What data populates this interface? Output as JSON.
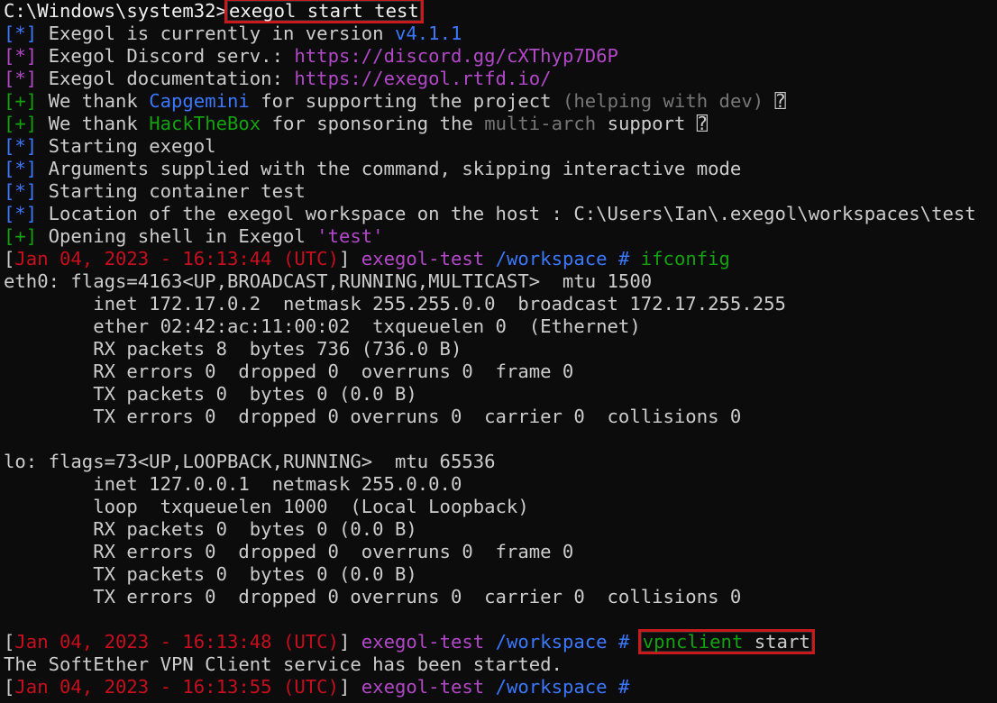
{
  "colors": {
    "background": "#0c0c0c",
    "default": "#cccccc",
    "bright": "#f2f2f2",
    "blue": "#3b78ff",
    "magenta": "#b148c6",
    "green": "#13a10e",
    "red": "#c50f1f",
    "gray": "#767676",
    "highlight_border": "#c8191c"
  },
  "lines": [
    [
      {
        "t": "C:\\Windows\\system32>",
        "c": "bright"
      },
      {
        "t": "exegol start test",
        "c": "bright",
        "hl": true
      }
    ],
    [
      {
        "t": "[*]",
        "c": "blue"
      },
      {
        "t": " Exegol is currently in version ",
        "c": "default"
      },
      {
        "t": "v4.1.1",
        "c": "blue"
      }
    ],
    [
      {
        "t": "[*]",
        "c": "magenta"
      },
      {
        "t": " Exegol Discord serv.: ",
        "c": "default"
      },
      {
        "t": "https://discord.gg/cXThyp7D6P",
        "c": "magenta"
      }
    ],
    [
      {
        "t": "[*]",
        "c": "magenta"
      },
      {
        "t": " Exegol documentation: ",
        "c": "default"
      },
      {
        "t": "https://exegol.rtfd.io/",
        "c": "magenta"
      }
    ],
    [
      {
        "t": "[+]",
        "c": "green"
      },
      {
        "t": " We thank ",
        "c": "default"
      },
      {
        "t": "Capgemini",
        "c": "blue"
      },
      {
        "t": " for supporting the project ",
        "c": "default"
      },
      {
        "t": "(helping with dev)",
        "c": "gray"
      },
      {
        "t": " ⍰",
        "c": "default"
      }
    ],
    [
      {
        "t": "[+]",
        "c": "green"
      },
      {
        "t": " We thank ",
        "c": "default"
      },
      {
        "t": "HackTheBox",
        "c": "green"
      },
      {
        "t": " for sponsoring the ",
        "c": "default"
      },
      {
        "t": "multi-arch",
        "c": "gray"
      },
      {
        "t": " support ⍰",
        "c": "default"
      }
    ],
    [
      {
        "t": "[*]",
        "c": "blue"
      },
      {
        "t": " Starting exegol",
        "c": "default"
      }
    ],
    [
      {
        "t": "[*]",
        "c": "blue"
      },
      {
        "t": " Arguments supplied with the command, skipping interactive mode",
        "c": "default"
      }
    ],
    [
      {
        "t": "[*]",
        "c": "blue"
      },
      {
        "t": " Starting container test",
        "c": "default"
      }
    ],
    [
      {
        "t": "[*]",
        "c": "blue"
      },
      {
        "t": " Location of the exegol workspace on the host : C:\\Users\\Ian\\.exegol\\workspaces\\test",
        "c": "default"
      }
    ],
    [
      {
        "t": "[+]",
        "c": "green"
      },
      {
        "t": " Opening shell in Exegol ",
        "c": "default"
      },
      {
        "t": "'test'",
        "c": "magenta"
      }
    ],
    [
      {
        "t": "[",
        "c": "default"
      },
      {
        "t": "Jan 04, 2023 - 16:13:44 (UTC)",
        "c": "red"
      },
      {
        "t": "]",
        "c": "default"
      },
      {
        "t": " exegol-test",
        "c": "magenta"
      },
      {
        "t": " /workspace #",
        "c": "blue"
      },
      {
        "t": " ifconfig",
        "c": "green"
      }
    ],
    [
      {
        "t": "eth0: flags=4163<UP,BROADCAST,RUNNING,MULTICAST>  mtu 1500",
        "c": "default"
      }
    ],
    [
      {
        "t": "        inet 172.17.0.2  netmask 255.255.0.0  broadcast 172.17.255.255",
        "c": "default"
      }
    ],
    [
      {
        "t": "        ether 02:42:ac:11:00:02  txqueuelen 0  (Ethernet)",
        "c": "default"
      }
    ],
    [
      {
        "t": "        RX packets 8  bytes 736 (736.0 B)",
        "c": "default"
      }
    ],
    [
      {
        "t": "        RX errors 0  dropped 0  overruns 0  frame 0",
        "c": "default"
      }
    ],
    [
      {
        "t": "        TX packets 0  bytes 0 (0.0 B)",
        "c": "default"
      }
    ],
    [
      {
        "t": "        TX errors 0  dropped 0 overruns 0  carrier 0  collisions 0",
        "c": "default"
      }
    ],
    [
      {
        "t": "",
        "c": "default"
      }
    ],
    [
      {
        "t": "lo: flags=73<UP,LOOPBACK,RUNNING>  mtu 65536",
        "c": "default"
      }
    ],
    [
      {
        "t": "        inet 127.0.0.1  netmask 255.0.0.0",
        "c": "default"
      }
    ],
    [
      {
        "t": "        loop  txqueuelen 1000  (Local Loopback)",
        "c": "default"
      }
    ],
    [
      {
        "t": "        RX packets 0  bytes 0 (0.0 B)",
        "c": "default"
      }
    ],
    [
      {
        "t": "        RX errors 0  dropped 0  overruns 0  frame 0",
        "c": "default"
      }
    ],
    [
      {
        "t": "        TX packets 0  bytes 0 (0.0 B)",
        "c": "default"
      }
    ],
    [
      {
        "t": "        TX errors 0  dropped 0 overruns 0  carrier 0  collisions 0",
        "c": "default"
      }
    ],
    [
      {
        "t": "",
        "c": "default"
      }
    ],
    [
      {
        "t": "[",
        "c": "default"
      },
      {
        "t": "Jan 04, 2023 - 16:13:48 (UTC)",
        "c": "red"
      },
      {
        "t": "]",
        "c": "default"
      },
      {
        "t": " exegol-test",
        "c": "magenta"
      },
      {
        "t": " /workspace #",
        "c": "blue"
      },
      {
        "t": " ",
        "c": "default"
      },
      {
        "t": "vpnclient",
        "c": "green",
        "hl": true,
        "hl_group": "a"
      },
      {
        "t": " start",
        "c": "default",
        "hl": true,
        "hl_group": "a"
      }
    ],
    [
      {
        "t": "The SoftEther VPN Client service has been started.",
        "c": "default"
      }
    ],
    [
      {
        "t": "[",
        "c": "default"
      },
      {
        "t": "Jan 04, 2023 - 16:13:55 (UTC)",
        "c": "red"
      },
      {
        "t": "]",
        "c": "default"
      },
      {
        "t": " exegol-test",
        "c": "magenta"
      },
      {
        "t": " /workspace #",
        "c": "blue"
      }
    ]
  ]
}
